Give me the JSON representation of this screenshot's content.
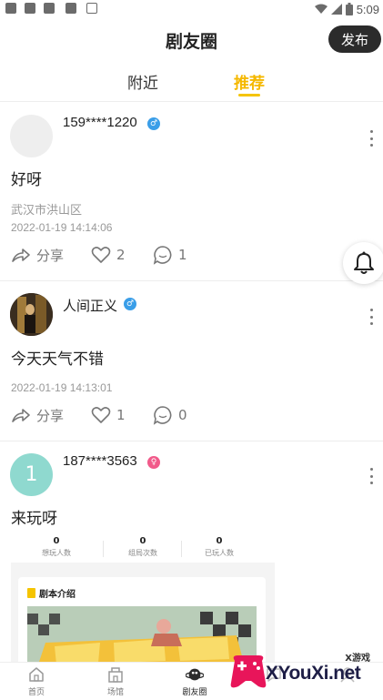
{
  "status_bar": {
    "time": "5:09"
  },
  "header": {
    "title": "剧友圈",
    "publish_label": "发布"
  },
  "tabs": [
    {
      "label": "附近",
      "active": false
    },
    {
      "label": "推荐",
      "active": true
    }
  ],
  "posts": [
    {
      "username": "159****1220",
      "gender": "male",
      "content": "好呀",
      "location": "武汉市洪山区",
      "time": "2022-01-19 14:14:06",
      "share_label": "分享",
      "likes": "2",
      "comments": "1"
    },
    {
      "username": "人间正义",
      "gender": "male",
      "content": "今天天气不错",
      "time": "2022-01-19 14:13:01",
      "share_label": "分享",
      "likes": "1",
      "comments": "0"
    },
    {
      "username": "187****3563",
      "gender": "female",
      "avatar_letter": "1",
      "content": "来玩呀",
      "embed": {
        "stats": [
          {
            "value": "0",
            "label": "想玩人数"
          },
          {
            "value": "0",
            "label": "组局次数"
          },
          {
            "value": "0",
            "label": "已玩人数"
          }
        ],
        "card_title": "剧本介绍"
      }
    }
  ],
  "bottom_nav": [
    {
      "label": "首页",
      "icon": "home-icon",
      "active": false
    },
    {
      "label": "场馆",
      "icon": "building-icon",
      "active": false
    },
    {
      "label": "剧友圈",
      "icon": "planet-icon",
      "active": true
    },
    {
      "label": "",
      "icon": "chat-icon",
      "active": false
    },
    {
      "label": "",
      "icon": "profile-icon",
      "active": false
    }
  ],
  "watermark": {
    "top_text": "X游戏",
    "main_text": "XYouXi.net"
  },
  "colors": {
    "accent": "#f5c400",
    "male": "#3a9ee8",
    "female": "#f15a8a",
    "avatar_teal": "#8fd9cf",
    "publish_bg": "#2b2b2b"
  }
}
